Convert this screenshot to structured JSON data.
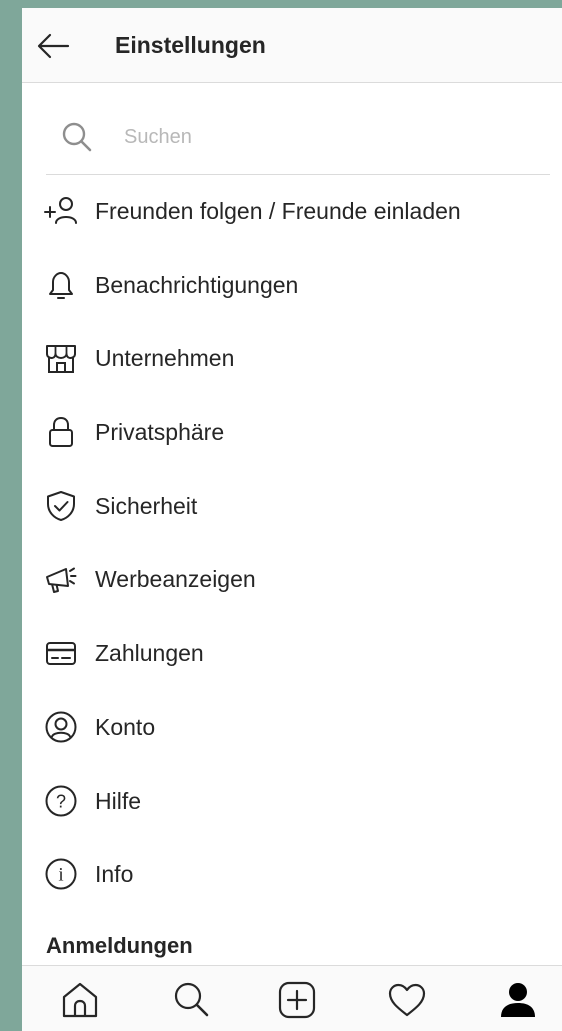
{
  "header": {
    "title": "Einstellungen"
  },
  "search": {
    "placeholder": "Suchen"
  },
  "menu": {
    "items": [
      {
        "label": "Freunden folgen / Freunde einladen",
        "icon": "add-user-icon"
      },
      {
        "label": "Benachrichtigungen",
        "icon": "bell-icon"
      },
      {
        "label": "Unternehmen",
        "icon": "shop-icon"
      },
      {
        "label": "Privatsphäre",
        "icon": "lock-icon"
      },
      {
        "label": "Sicherheit",
        "icon": "shield-icon"
      },
      {
        "label": "Werbeanzeigen",
        "icon": "megaphone-icon"
      },
      {
        "label": "Zahlungen",
        "icon": "card-icon"
      },
      {
        "label": "Konto",
        "icon": "account-icon"
      },
      {
        "label": "Hilfe",
        "icon": "help-icon"
      },
      {
        "label": "Info",
        "icon": "info-icon"
      }
    ]
  },
  "logins": {
    "heading": "Anmeldungen"
  },
  "tabbar": {
    "tabs": [
      {
        "icon": "home-icon"
      },
      {
        "icon": "search-icon"
      },
      {
        "icon": "plus-icon"
      },
      {
        "icon": "heart-icon"
      },
      {
        "icon": "profile-icon"
      }
    ]
  },
  "colors": {
    "background": "#7fa79a",
    "text": "#262626",
    "divider": "#dbdbdb",
    "placeholder": "#b8b8b8"
  }
}
